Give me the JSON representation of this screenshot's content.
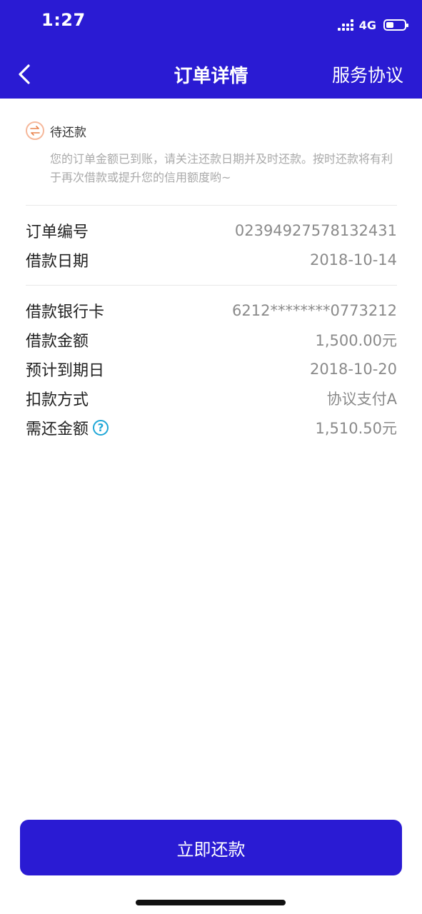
{
  "status_bar": {
    "time": "1:27",
    "network": "4G"
  },
  "nav": {
    "title": "订单详情",
    "right_link": "服务协议"
  },
  "order_status": {
    "label": "待还款",
    "description": "您的订单金额已到账，请关注还款日期并及时还款。按时还款将有利于再次借款或提升您的信用额度哟~",
    "icon": "swap-arrows-icon"
  },
  "order_info": [
    {
      "label": "订单编号",
      "value": "023949275781324​31"
    },
    {
      "label": "借款日期",
      "value": "2018-10-14"
    }
  ],
  "loan_info": [
    {
      "label": "借款银行卡",
      "value": "6212********0773212"
    },
    {
      "label": "借款金额",
      "value": "1,500.00元"
    },
    {
      "label": "预计到期日",
      "value": "2018-10-20"
    },
    {
      "label": "扣款方式",
      "value": "协议支付A"
    },
    {
      "label": "需还金额",
      "value": "1,510.50元",
      "help": "?"
    }
  ],
  "repay_button": {
    "label": "立即还款"
  },
  "colors": {
    "brand": "#2A1BD3",
    "status_icon": "#E9834D",
    "help_icon": "#1FA7D7"
  }
}
